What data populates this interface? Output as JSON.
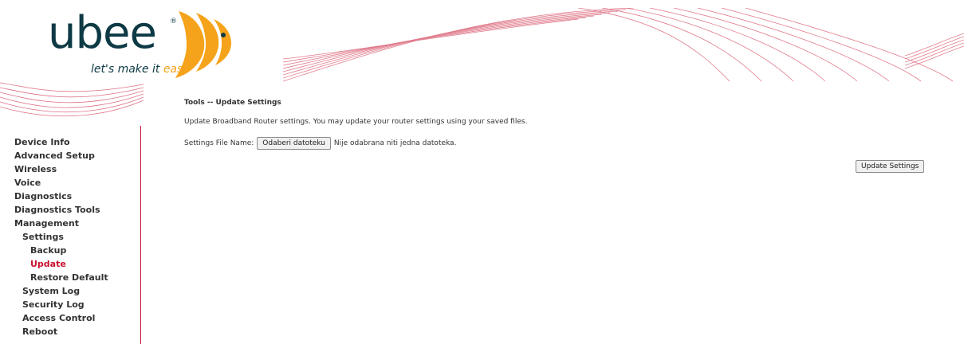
{
  "header": {
    "logo_text": "ubee",
    "logo_reg": "®",
    "tagline_main": "let's make it ",
    "tagline_accent": "easy",
    "logo_color": "#0d3a44",
    "accent_color": "#f5a31a",
    "wave_color": "#c8102e"
  },
  "sidebar": {
    "items": [
      {
        "label": "Device Info"
      },
      {
        "label": "Advanced Setup"
      },
      {
        "label": "Wireless"
      },
      {
        "label": "Voice"
      },
      {
        "label": "Diagnostics"
      },
      {
        "label": "Diagnostics Tools"
      },
      {
        "label": "Management"
      },
      {
        "label": "Settings"
      },
      {
        "label": "Backup"
      },
      {
        "label": "Update"
      },
      {
        "label": "Restore Default"
      },
      {
        "label": "System Log"
      },
      {
        "label": "Security Log"
      },
      {
        "label": "Access Control"
      },
      {
        "label": "Reboot"
      }
    ],
    "active_color": "#c8102e"
  },
  "main": {
    "title": "Tools -- Update Settings",
    "description": "Update Broadband Router settings. You may update your router settings using your saved files.",
    "file_label": "Settings File Name:",
    "choose_button": "Odaberi datoteku",
    "file_status": "Nije odabrana niti jedna datoteka.",
    "update_button": "Update Settings"
  }
}
